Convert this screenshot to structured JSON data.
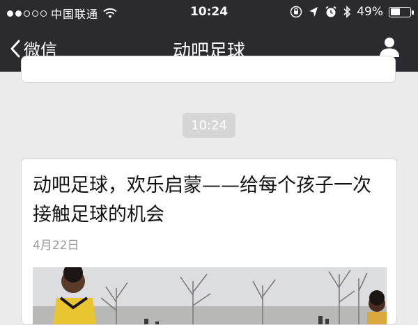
{
  "status_bar": {
    "carrier": "中国联通",
    "time": "10:24",
    "battery_percent": "49%",
    "battery_level": 0.49,
    "signal_filled": 2,
    "signal_total": 5
  },
  "nav": {
    "back_label": "微信",
    "title": "动吧足球"
  },
  "feed": {
    "time_divider": "10:24",
    "article": {
      "title": "动吧足球，欢乐启蒙——给每个孩子一次接触足球的机会",
      "date": "4月22日"
    }
  },
  "colors": {
    "topbar": "#2b2b2f",
    "background": "#ebebeb",
    "card": "#ffffff",
    "divider_badge": "#d6d6d6",
    "date_text": "#9a9a9a"
  }
}
